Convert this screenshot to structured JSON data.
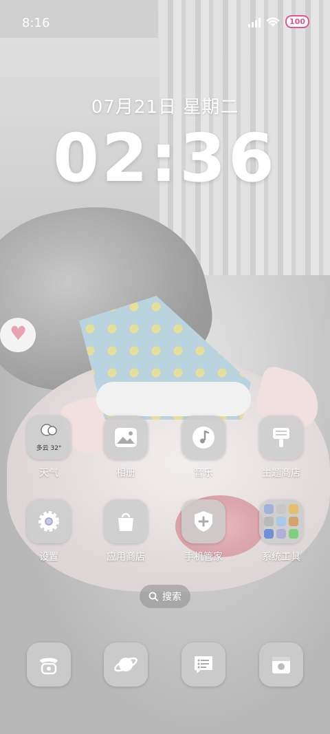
{
  "status_bar": {
    "time": "8:16",
    "battery": "100"
  },
  "lockscreen": {
    "date": "07月21日 星期二",
    "time": "02:36"
  },
  "weather_widget": {
    "condition": "多云",
    "temperature": "32°"
  },
  "apps": [
    {
      "label": "天气",
      "icon": "weather-cloud-icon"
    },
    {
      "label": "相册",
      "icon": "photo-icon"
    },
    {
      "label": "音乐",
      "icon": "music-note-icon"
    },
    {
      "label": "主题商店",
      "icon": "paintbrush-icon"
    },
    {
      "label": "设置",
      "icon": "gear-icon"
    },
    {
      "label": "应用商店",
      "icon": "shopping-bag-icon"
    },
    {
      "label": "手机管家",
      "icon": "shield-plus-icon"
    },
    {
      "label": "系统工具",
      "icon": "folder-icon"
    }
  ],
  "search": {
    "label": "搜索"
  },
  "dock": [
    {
      "icon": "phone-icon"
    },
    {
      "icon": "browser-planet-icon"
    },
    {
      "icon": "message-icon"
    },
    {
      "icon": "camera-icon"
    }
  ],
  "colors": {
    "battery_accent": "#e0578f",
    "tile_bg": "#cdcdcd"
  }
}
